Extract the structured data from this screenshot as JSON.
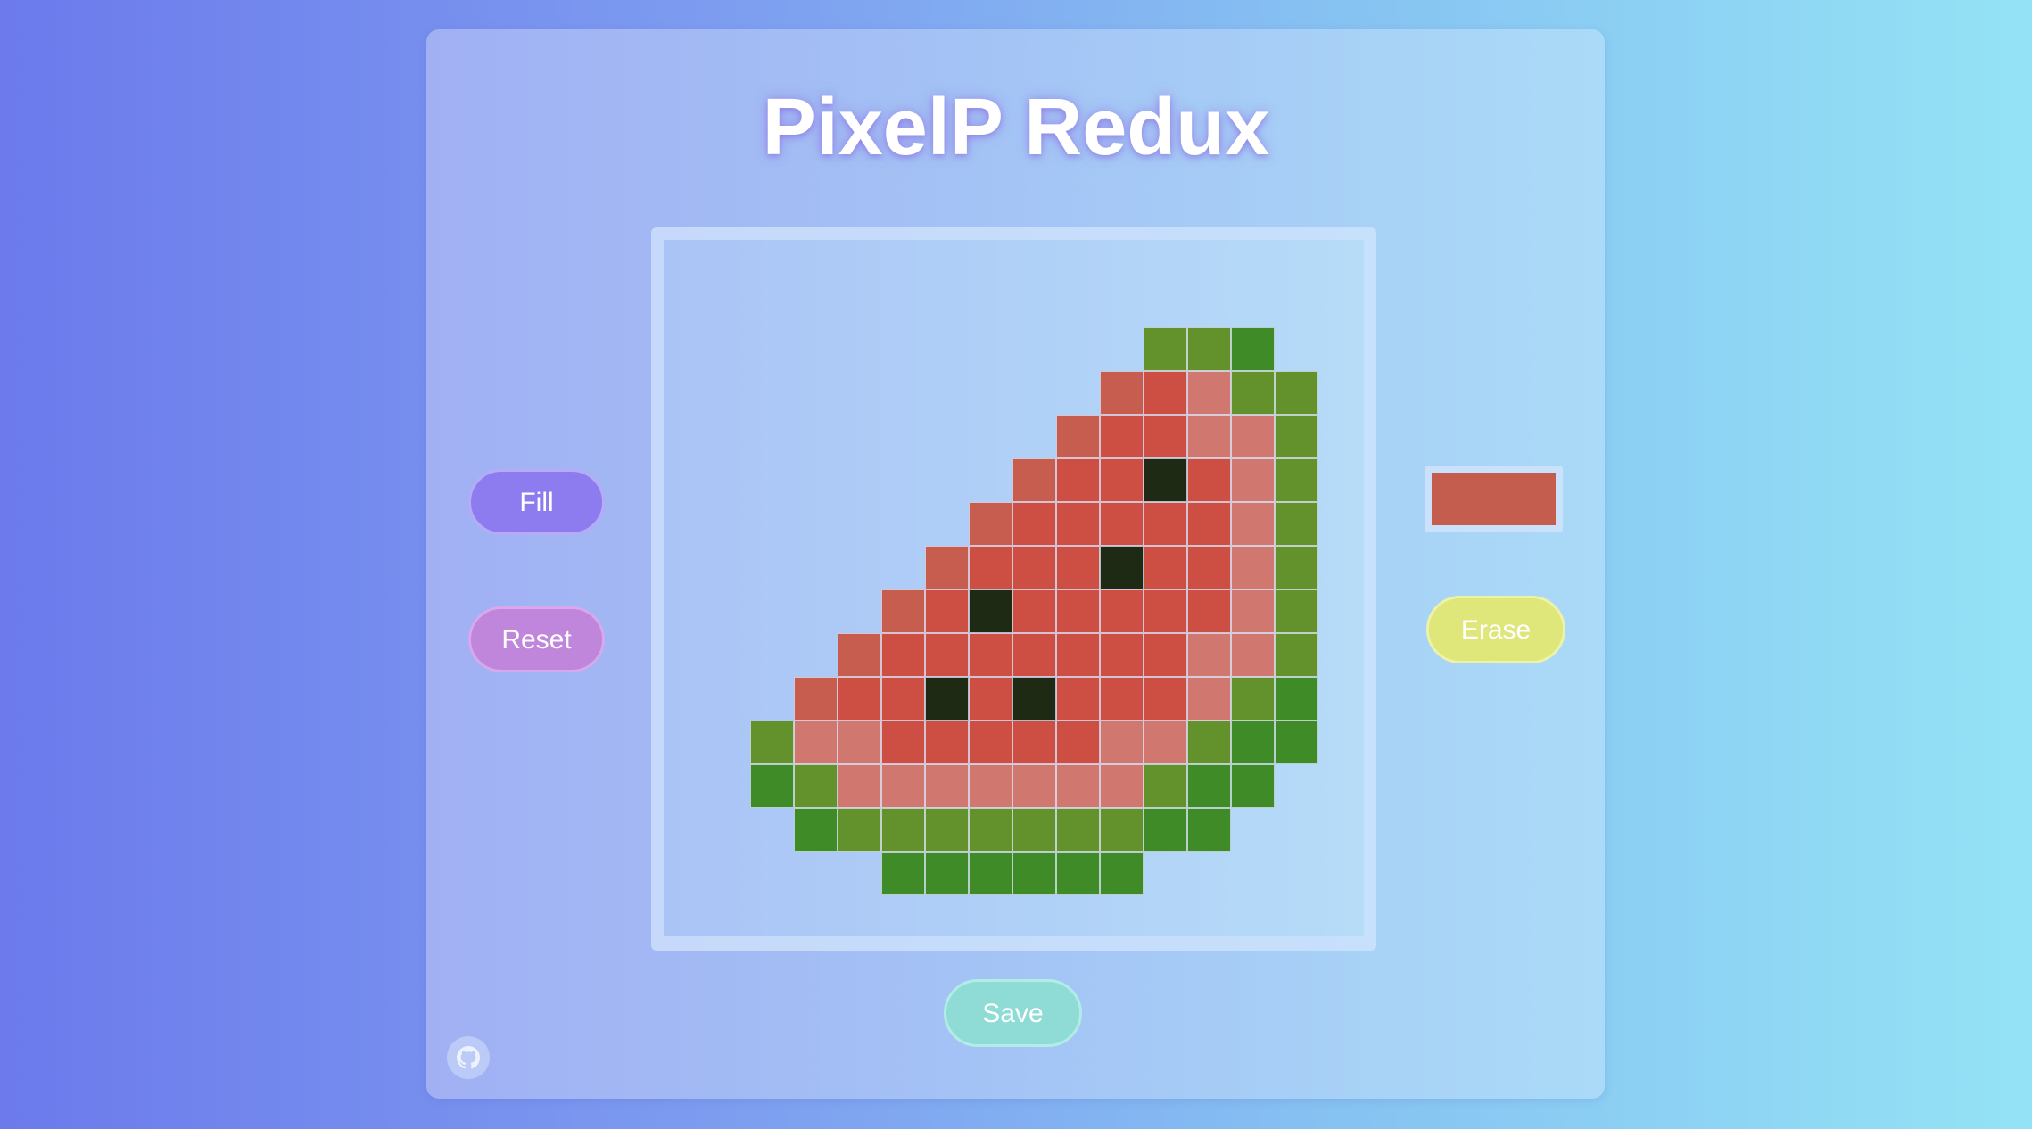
{
  "app": {
    "title": "PixelP Redux"
  },
  "controls": {
    "fill_label": "Fill",
    "reset_label": "Reset",
    "erase_label": "Erase",
    "save_label": "Save"
  },
  "color_picker": {
    "selected_color": "#c55d4f"
  },
  "footer": {
    "github_icon": "github-icon"
  },
  "palette": {
    "R": "#c65d4f",
    "r": "#cd4e43",
    "p": "#d07870",
    "D": "#1f2a15",
    "G": "#3f8b28",
    "g": "#63912b"
  },
  "grid": {
    "columns": 14,
    "rows": 13,
    "pixels": [
      "..........ggG.",
      ".........Rrpgg",
      "........RrrppgG",
      ".......RrrDrpgG",
      "......RrrrrrpgG",
      ".....RrrrDrrpgG",
      "....RrDrrrrrpgG",
      "...Rrrrrrrrppg G",
      "..RrrDrDrrrpgG.",
      ".gpprrrrrppgGG.",
      ".GgpppppppgGG..",
      "..GgggggggGG...",
      "....GGGGGG....."
    ]
  }
}
